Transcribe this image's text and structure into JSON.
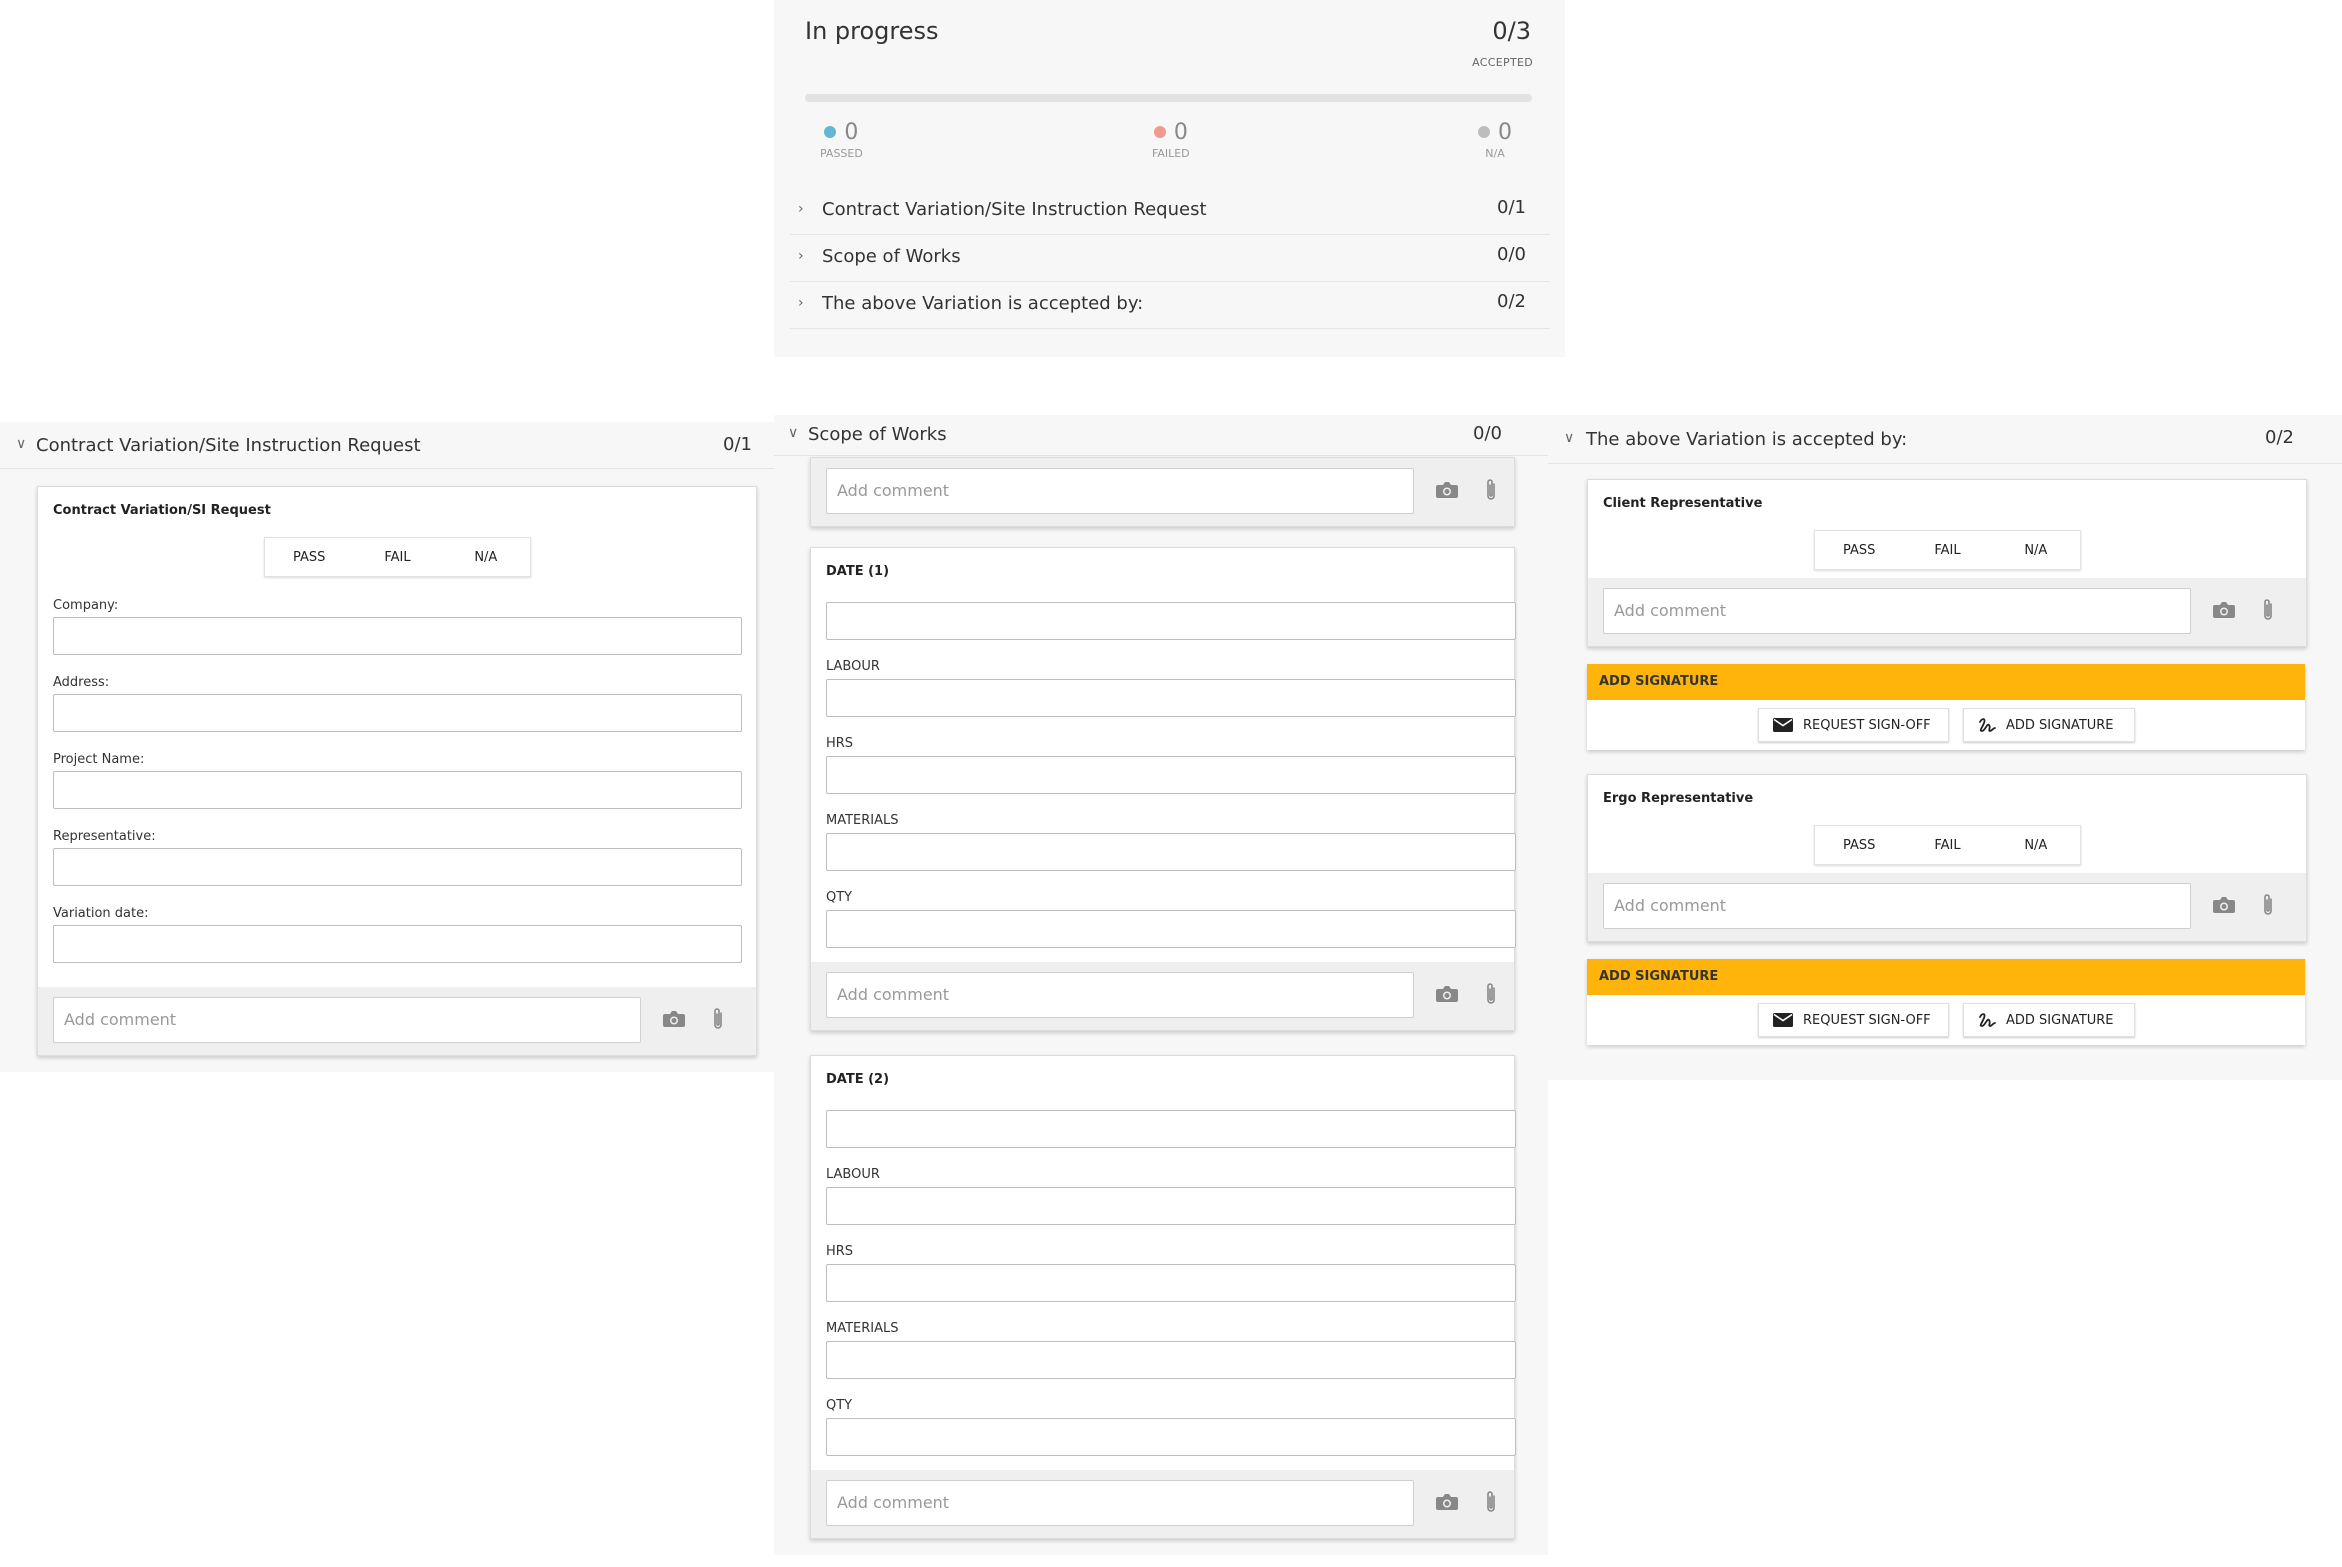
{
  "summary": {
    "status_title": "In progress",
    "accepted_count": "0/3",
    "accepted_label": "ACCEPTED",
    "progress_fraction": 0,
    "stats": [
      {
        "count": "0",
        "label": "PASSED",
        "color": "#62b8d4"
      },
      {
        "count": "0",
        "label": "FAILED",
        "color": "#f19a8f"
      },
      {
        "count": "0",
        "label": "N/A",
        "color": "#bdbdbd"
      }
    ],
    "sections": [
      {
        "label": "Contract Variation/Site Instruction Request",
        "count": "0/1"
      },
      {
        "label": "Scope of Works",
        "count": "0/0"
      },
      {
        "label": "The above Variation is accepted by:",
        "count": "0/2"
      }
    ]
  },
  "contract_section": {
    "header": "Contract Variation/Site Instruction Request",
    "count": "0/1",
    "card_title": "Contract Variation/SI Request",
    "pass_label": "PASS",
    "fail_label": "FAIL",
    "na_label": "N/A",
    "fields": [
      "Company:",
      "Address:",
      "Project Name:",
      "Representative:",
      "Variation date:"
    ],
    "comment_placeholder": "Add comment"
  },
  "scope_section": {
    "header": "Scope of Works",
    "count": "0/0",
    "comment_placeholder": "Add comment",
    "days": [
      {
        "title": "DATE (1)",
        "fields": [
          "LABOUR",
          "HRS",
          "MATERIALS",
          "QTY"
        ]
      },
      {
        "title": "DATE (2)",
        "fields": [
          "LABOUR",
          "HRS",
          "MATERIALS",
          "QTY"
        ]
      }
    ]
  },
  "accept_section": {
    "header": "The above Variation is accepted by:",
    "count": "0/2",
    "pass_label": "PASS",
    "fail_label": "FAIL",
    "na_label": "N/A",
    "comment_placeholder": "Add comment",
    "add_signature_label": "ADD SIGNATURE",
    "request_signoff_label": "REQUEST SIGN-OFF",
    "reps": [
      "Client Representative",
      "Ergo Representative"
    ]
  },
  "colors": {
    "signature_bar": "#ffb40b",
    "progress": "#64b5cf"
  },
  "icons": [
    "chevron-right-icon",
    "chevron-down-icon",
    "camera-icon",
    "paperclip-icon",
    "envelope-icon",
    "signature-icon"
  ]
}
